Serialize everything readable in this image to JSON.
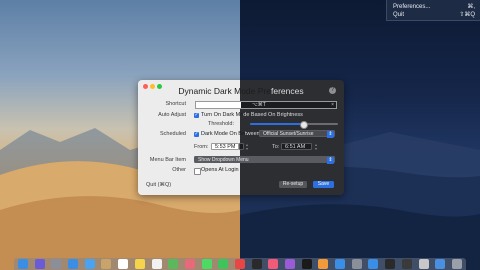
{
  "menubar_popup": {
    "items": [
      {
        "label": "Preferences...",
        "shortcut": "⌘,"
      },
      {
        "label": "Quit",
        "shortcut": "⇧⌘Q"
      }
    ]
  },
  "dialog": {
    "title_left": "Dynamic Dark Mode Pre",
    "title_right": "ferences",
    "help": "?",
    "shortcut": {
      "label": "Shortcut",
      "value": "⌥⌘T",
      "clear": "×"
    },
    "auto_adjust": {
      "label": "Auto Adjust",
      "text_left": "Turn On Dark Mo",
      "text_right": "de Based On Brightness",
      "checked": true
    },
    "threshold": {
      "label": "Threshold:",
      "value_percent": 60
    },
    "scheduled": {
      "label": "Scheduled",
      "text_left": "Dark Mode On Be",
      "text_right": "tween",
      "checked": true,
      "option": "Official Sunset/Sunrise"
    },
    "from": {
      "label": "From:",
      "value": "5:53 PM"
    },
    "to": {
      "label": "To:",
      "value": "6:51 AM"
    },
    "menu_bar_item": {
      "label": "Menu Bar Item",
      "option": "Show Dropdown Menu"
    },
    "other": {
      "label": "Other",
      "text": "Opens At Login",
      "checked": false
    },
    "quit": "Quit (⌘Q)",
    "resetup": "Re-setup",
    "save": "Save"
  },
  "dock": {
    "icons": [
      "finder-icon",
      "siri-icon",
      "launchpad-icon",
      "safari-icon",
      "mail-icon",
      "contacts-icon",
      "calendar-icon",
      "notes-icon",
      "reminders-icon",
      "maps-icon",
      "photos-icon",
      "messages-icon",
      "facetime-icon",
      "news-icon",
      "stocks-icon",
      "music-icon",
      "podcasts-icon",
      "tv-icon",
      "books-icon",
      "appstore-icon",
      "preferences-icon",
      "xcode-icon",
      "terminal-icon",
      "activity-icon",
      "script-icon",
      "folder-icon",
      "trash-icon"
    ],
    "colors": [
      "#3a8ee6",
      "#6b5bd6",
      "#8a8f99",
      "#3a8ee6",
      "#4aa3f0",
      "#c8a46a",
      "#ffffff",
      "#f5d34a",
      "#f2f2f2",
      "#5cb85c",
      "#e86a7a",
      "#4cd964",
      "#3ec45a",
      "#e84545",
      "#2a2a2a",
      "#f25a7a",
      "#9a5bd6",
      "#1a1a1a",
      "#f29a3a",
      "#3a8ee6",
      "#8a8f99",
      "#3a8ee6",
      "#2a2a2a",
      "#3a3a3a",
      "#c8c8c8",
      "#4a8fe0",
      "#9aa0aa"
    ]
  }
}
